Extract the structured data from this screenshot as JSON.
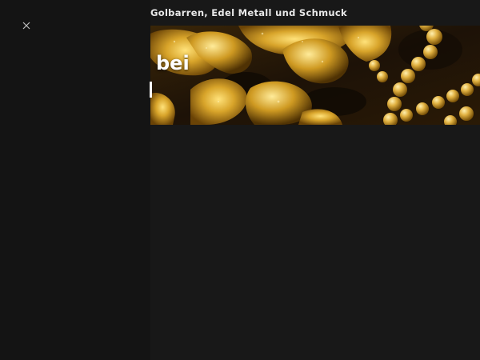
{
  "header": {
    "site_title": "Golbarren, Edel Metall und Schmuck"
  },
  "drawer": {
    "close_icon": "close-icon"
  },
  "hero": {
    "image": "gold-jewelry-image",
    "heading_fragment": "bei"
  },
  "colors": {
    "background": "#181818",
    "sidebar": "#141414",
    "title_text": "#e8e8e8",
    "gold": "#d4a52a"
  }
}
